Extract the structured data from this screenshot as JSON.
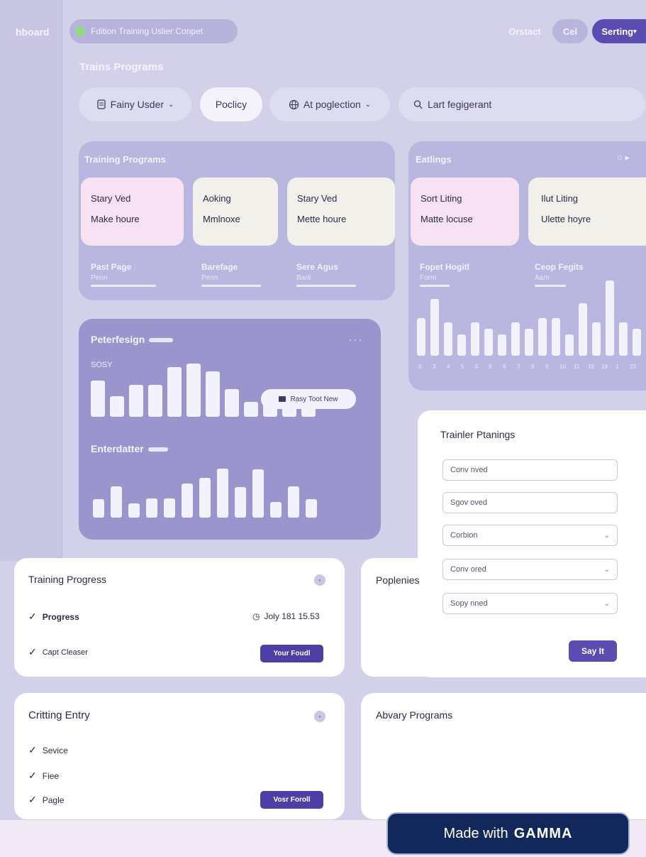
{
  "nav": {
    "dashboard_label": "hboard",
    "status": "Fdition Training Uslier Conpet",
    "contact": "Orstact",
    "cel": "Cel",
    "setting": "Serting"
  },
  "page": {
    "title": "Trains Programs"
  },
  "filters": [
    {
      "label": "Fainy Usder",
      "icon": "file-icon",
      "has_chevron": true
    },
    {
      "label": "Poclicy",
      "icon": "",
      "has_chevron": false
    },
    {
      "label": "At poglection",
      "icon": "globe-icon",
      "has_chevron": true
    },
    {
      "label": "Lart fegigerant",
      "icon": "search-icon",
      "has_chevron": false
    }
  ],
  "training_programs": {
    "title": "Training Programs",
    "cards": [
      {
        "line1": "Stary Ved",
        "line2": "Make houre",
        "color": "#f7e2f3"
      },
      {
        "line1": "Aoking",
        "line2": "Mmlnoxe",
        "color": "#f1f0eb"
      },
      {
        "line1": "Stary Ved",
        "line2": "Mette houre",
        "color": "#f1f0eb"
      }
    ],
    "subs": [
      {
        "title": "Past Page",
        "small": "Penn"
      },
      {
        "title": "Barefage",
        "small": "Penn"
      },
      {
        "title": "Sere Agus",
        "small": "Barti"
      }
    ]
  },
  "earnings": {
    "title": "Eatlings",
    "cards": [
      {
        "line1": "Sort Liting",
        "line2": "Matte locuse",
        "color": "#f7e2f3"
      },
      {
        "line1": "Ilut Liting",
        "line2": "Ulette hoyre",
        "color": "#f1f0eb"
      }
    ],
    "subs": [
      {
        "title": "Fopet Hogitl",
        "small": "Form"
      },
      {
        "title": "Ceop Fegits",
        "small": "Aam"
      }
    ],
    "x_labels": [
      "0",
      "3",
      "4",
      "5",
      "5",
      "6",
      "6",
      "7",
      "9",
      "9",
      "10",
      "11",
      "19",
      "19",
      "1",
      "23"
    ],
    "bar_levels": [
      0.5,
      0.75,
      0.44,
      0.28,
      0.44,
      0.36,
      0.28,
      0.44,
      0.36,
      0.5,
      0.5,
      0.28,
      0.7,
      0.44,
      1.0,
      0.44,
      0.36
    ]
  },
  "performance": {
    "title": "Peterfesign",
    "label": "SOSY",
    "bars_top_levels": [
      0.62,
      0.35,
      0.55,
      0.55,
      0.85,
      0.92,
      0.78,
      0.48,
      0.26,
      0.22,
      0.2,
      0.2
    ],
    "tag": "Rasy Toot New",
    "sub_title": "Enterdatter",
    "bars_bottom_levels": [
      0.35,
      0.6,
      0.27,
      0.36,
      0.36,
      0.65,
      0.76,
      0.93,
      0.58,
      0.92,
      0.3,
      0.6,
      0.35
    ]
  },
  "trainer": {
    "title": "Trainler Ptanings",
    "fields": [
      {
        "value": "Conv nved",
        "chevron": false
      },
      {
        "value": "Sgov oved",
        "chevron": false
      },
      {
        "value": "Corbion",
        "chevron": true
      },
      {
        "value": "Conv ored",
        "chevron": true
      },
      {
        "value": "Sopy nned",
        "chevron": true
      }
    ],
    "side_label": "Poplenies",
    "save": "Say It"
  },
  "training_progress": {
    "title": "Training Progress",
    "rows": [
      {
        "label": "Progress",
        "meta": "Joly 181 15.53"
      },
      {
        "label": "Capt Cleaser",
        "button": "Your Foudl"
      }
    ]
  },
  "critting": {
    "title": "Critting Entry",
    "items": [
      "Sevice",
      "Fiee",
      "Pagle"
    ],
    "button": "Vosr Foroll"
  },
  "library": {
    "title": "Abvary Programs"
  },
  "badge": {
    "prefix": "Made with",
    "brand": "GAMMA"
  },
  "colors": {
    "accent": "#5b4cb2",
    "panel": "#b9b6df",
    "chart_panel": "#9a96cd",
    "badge": "#12285b"
  }
}
